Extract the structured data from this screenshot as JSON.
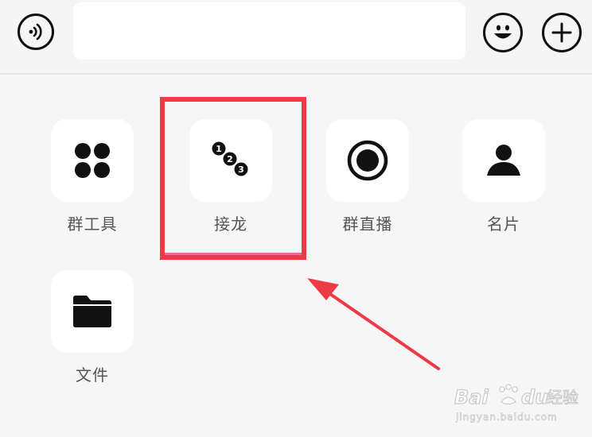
{
  "input_bar": {
    "voice_icon": "voice-icon",
    "message_value": "",
    "message_placeholder": "",
    "emoji_icon": "emoji-icon",
    "more_icon": "plus-icon"
  },
  "panel": {
    "items": [
      {
        "label": "群工具",
        "icon": "group-tools-icon"
      },
      {
        "label": "接龙",
        "icon": "numbered-chain-icon"
      },
      {
        "label": "群直播",
        "icon": "live-broadcast-icon"
      },
      {
        "label": "名片",
        "icon": "contact-card-icon"
      },
      {
        "label": "文件",
        "icon": "folder-icon"
      }
    ]
  },
  "annotation": {
    "box_color": "#ee3a45",
    "arrow_color": "#ee3a45"
  },
  "watermark": {
    "brand_a": "Bai",
    "brand_b": "du",
    "brand_cn": "经验",
    "url": "jingyan.baidu.com"
  }
}
